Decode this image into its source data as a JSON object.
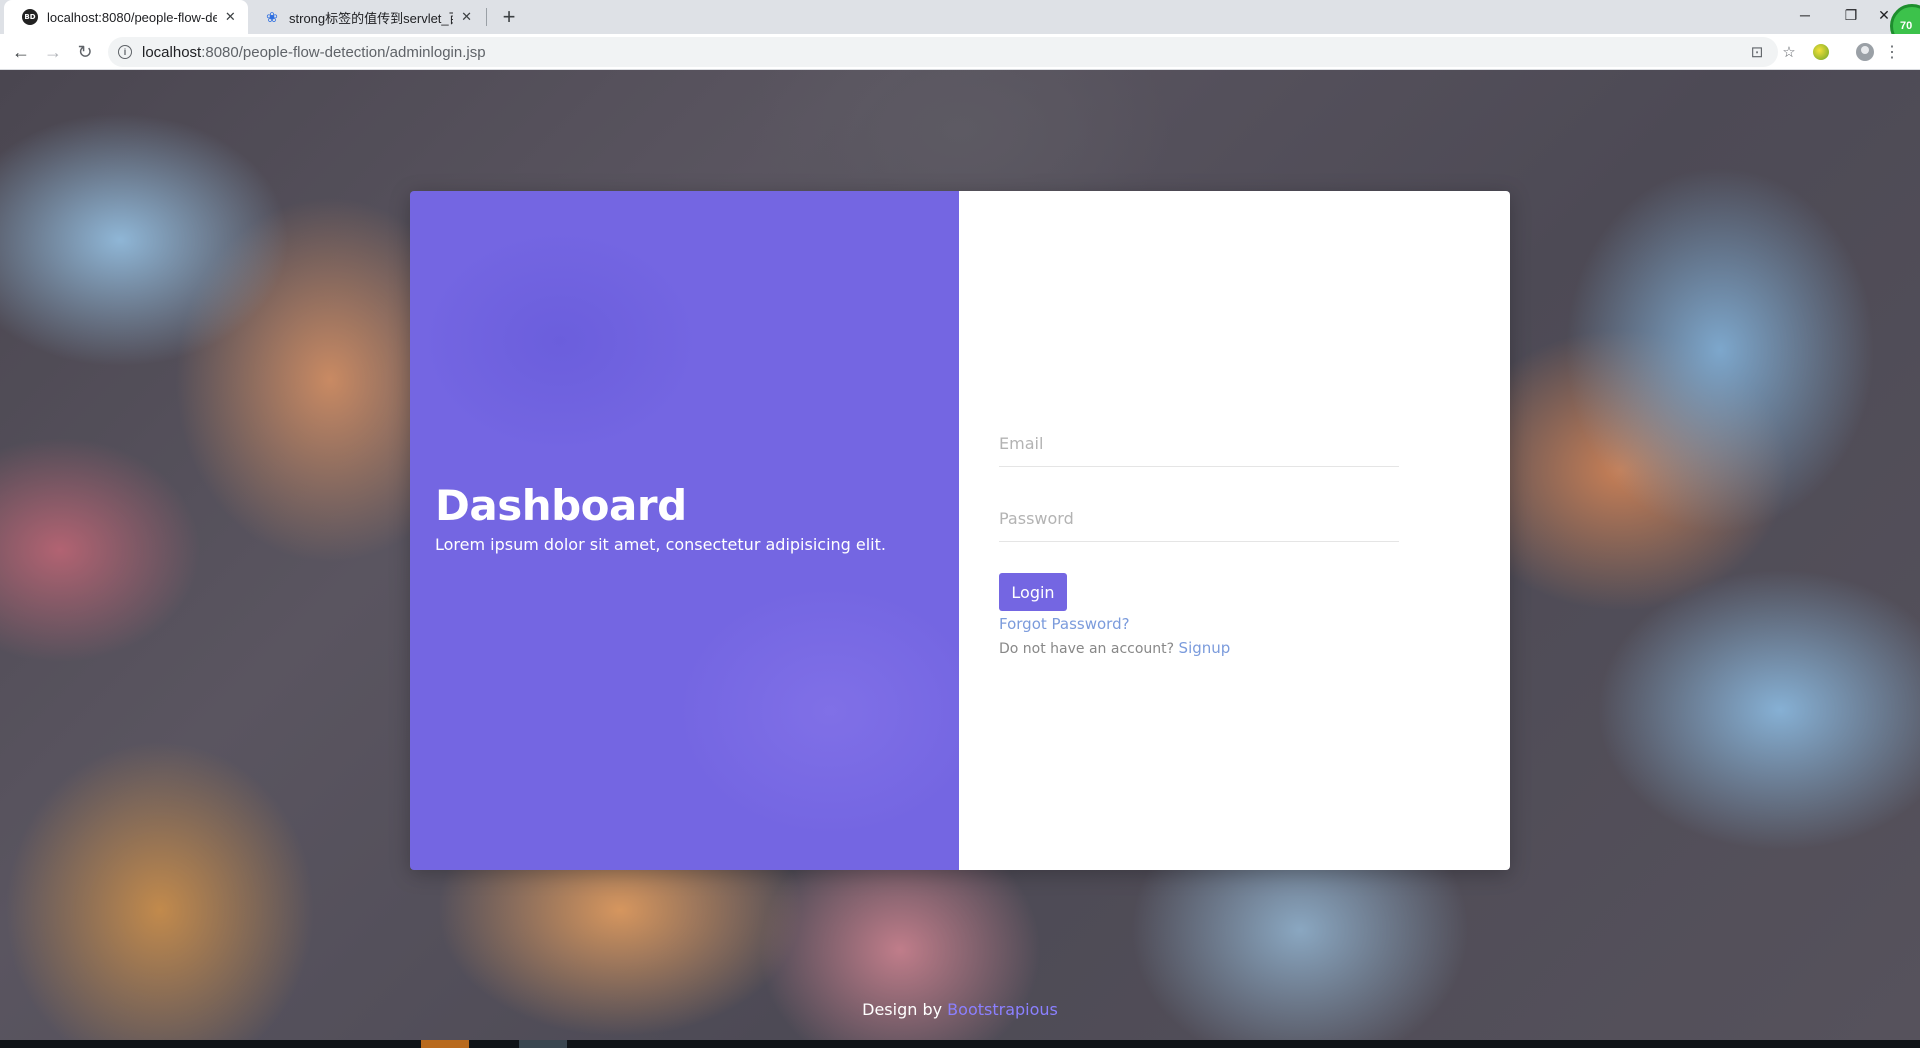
{
  "browser": {
    "tabs": [
      {
        "title": "localhost:8080/people-flow-de",
        "favicon": "BD",
        "active": true
      },
      {
        "title": "strong标签的值传到servlet_百度",
        "favicon": "paw-icon",
        "active": false
      }
    ],
    "address": {
      "host": "localhost",
      "rest": ":8080/people-flow-detection/adminlogin.jsp"
    },
    "extension_badge": "70"
  },
  "page": {
    "hero": {
      "title": "Dashboard",
      "subtitle": "Lorem ipsum dolor sit amet, consectetur adipisicing elit."
    },
    "form": {
      "email_placeholder": "Email",
      "password_placeholder": "Password",
      "login_label": "Login",
      "forgot_label": "Forgot Password?",
      "no_account_text": "Do not have an account?",
      "signup_label": "Signup"
    },
    "footer": {
      "prefix": "Design by",
      "link": "Bootstrapious"
    },
    "colors": {
      "accent": "#7466e2",
      "link": "#7b9bdc"
    }
  }
}
